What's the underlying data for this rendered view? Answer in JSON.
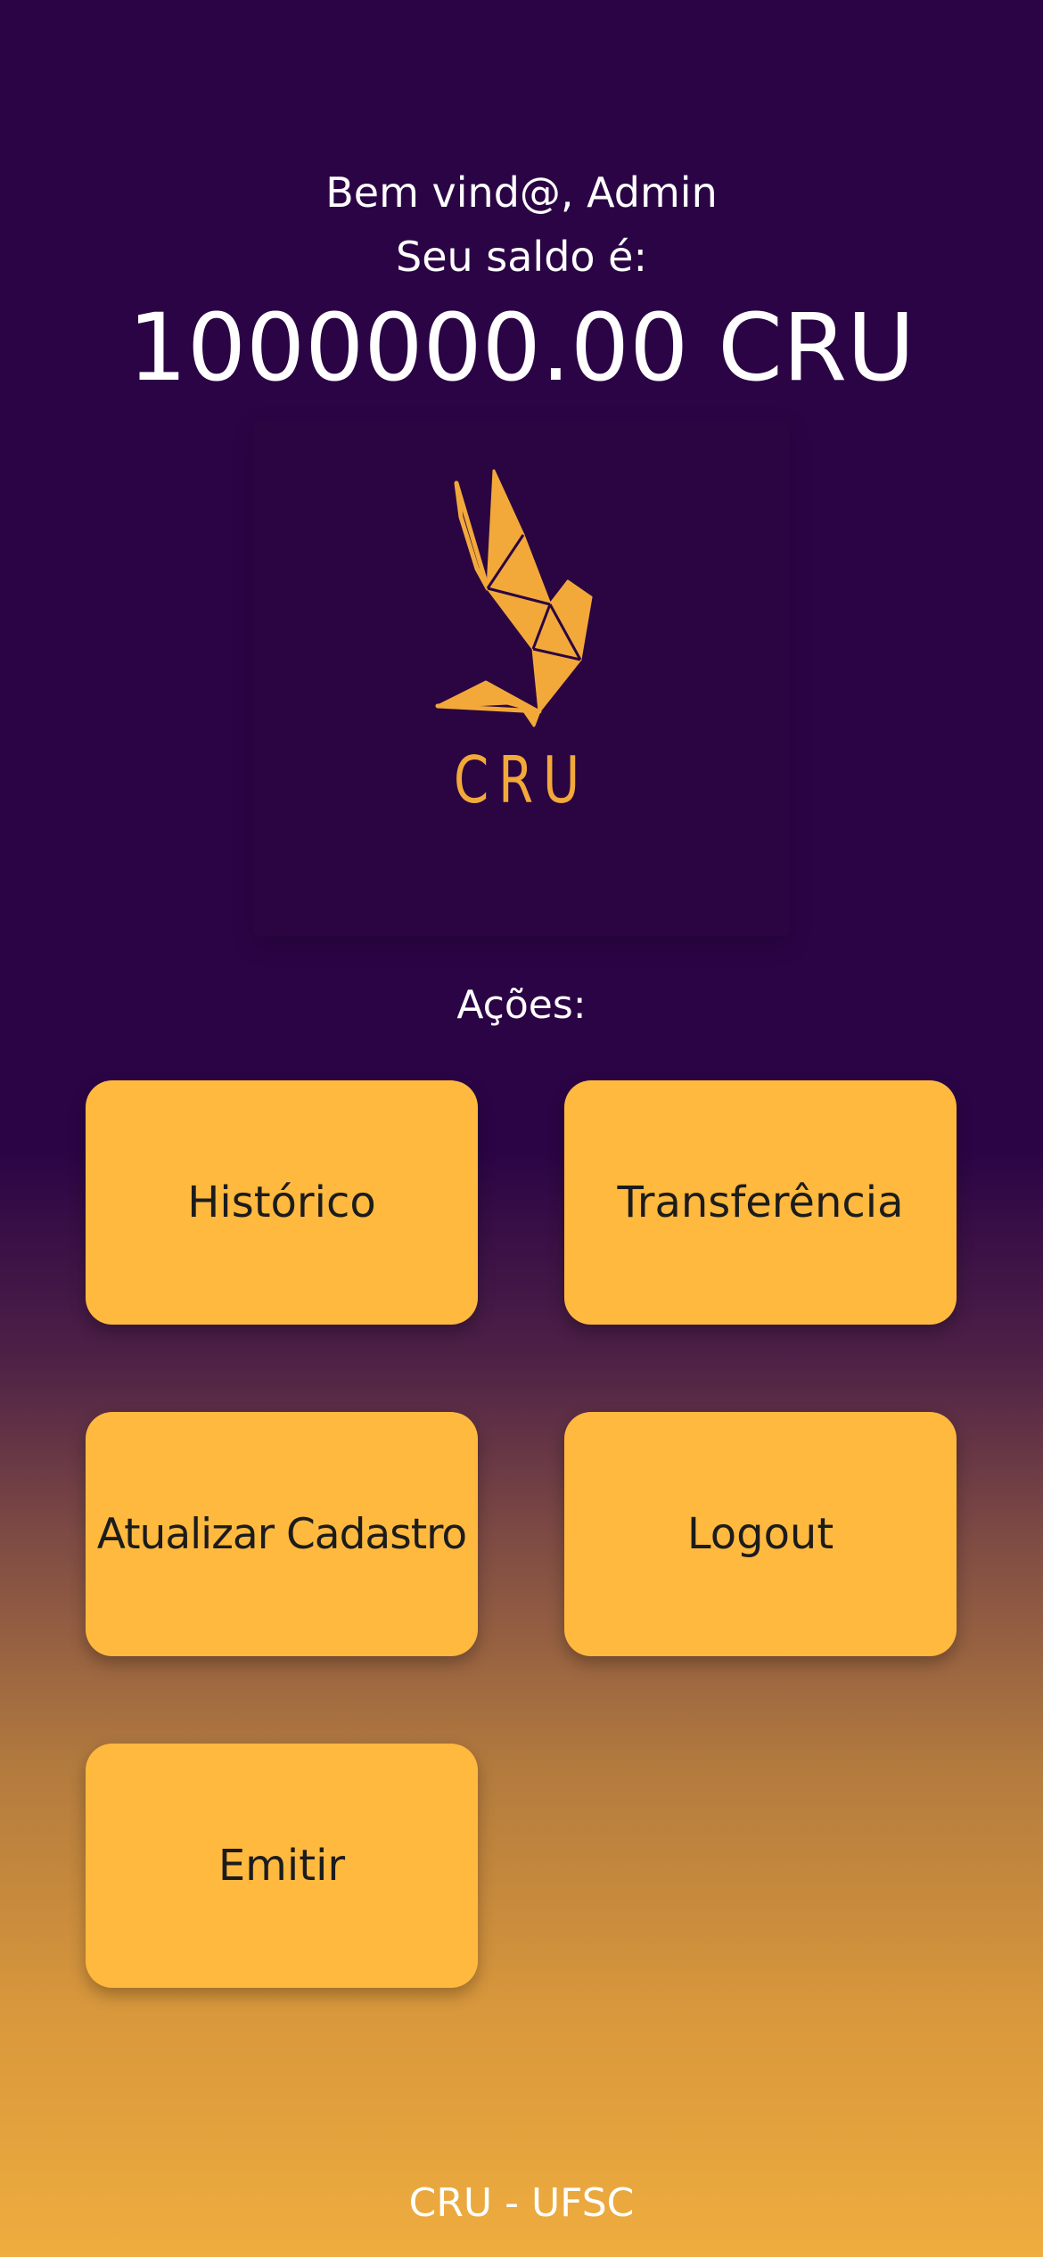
{
  "header": {
    "greeting": "Bem vind@, Admin",
    "balance_label": "Seu saldo é:",
    "balance": "1000000.00 CRU"
  },
  "logo": {
    "icon": "origami-bird-icon",
    "text": "CRU",
    "color": "#f2a93a"
  },
  "actions": {
    "label": "Ações:",
    "historico": "Histórico",
    "transferencia": "Transferência",
    "atualizar_cadastro": "Atualizar Cadastro",
    "logout": "Logout",
    "emitir": "Emitir"
  },
  "footer": {
    "text": "CRU - UFSC"
  },
  "colors": {
    "background_top": "#2b0445",
    "background_bottom": "#efad3e",
    "button": "#ffb93f",
    "text": "#ffffff"
  }
}
